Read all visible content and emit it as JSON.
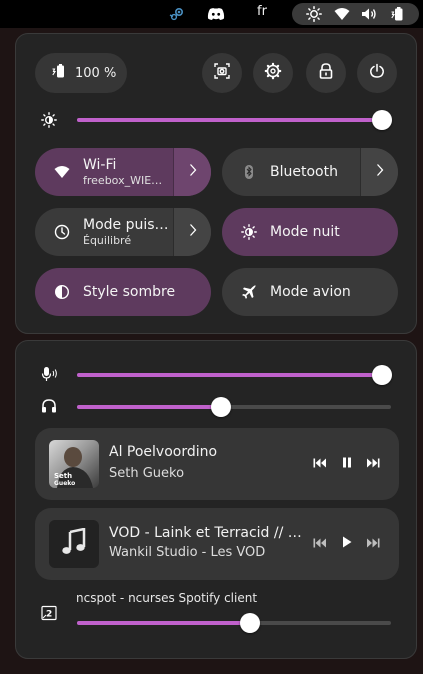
{
  "topbar": {
    "language": "fr",
    "icons": [
      "steam-icon",
      "discord-icon",
      "brightness-icon",
      "wifi-icon",
      "volume-icon",
      "battery-icon"
    ]
  },
  "quick_settings": {
    "battery_label": "100 %",
    "action_buttons": [
      "screenshot-icon",
      "settings-icon",
      "lock-icon",
      "power-icon"
    ],
    "brightness_level": 0.97,
    "toggles": [
      {
        "title": "Wi-Fi",
        "subtitle": "freebox_WIE…",
        "active": true,
        "has_arrow": true
      },
      {
        "title": "Bluetooth",
        "subtitle": "",
        "active": false,
        "has_arrow": true
      },
      {
        "title": "Mode puis…",
        "subtitle": "Équilibré",
        "active": false,
        "has_arrow": true
      },
      {
        "title": "Mode nuit",
        "subtitle": "",
        "active": true,
        "has_arrow": false
      },
      {
        "title": "Style sombre",
        "subtitle": "",
        "active": true,
        "has_arrow": false
      },
      {
        "title": "Mode avion",
        "subtitle": "",
        "active": false,
        "has_arrow": false
      }
    ]
  },
  "audio": {
    "microphone_level": 0.97,
    "headphones_level": 0.46,
    "app_stream_label": "ncspot - ncurses Spotify client",
    "app_stream_level": 0.55
  },
  "media_players": [
    {
      "title": "Al Poelvoordino",
      "artist": "Seth Gueko",
      "state": "playing",
      "cover_text": "Seth Gueko"
    },
    {
      "title": "VOD - Laink et Terracid // …",
      "artist": "Wankil Studio - Les VOD",
      "state": "paused"
    }
  ],
  "colors": {
    "accent": "#c061cb",
    "toggle_active": "#5e3a5e",
    "toggle_inactive": "#3a3a3a",
    "panel_bg": "#242424",
    "topbar_bg": "#000000"
  }
}
